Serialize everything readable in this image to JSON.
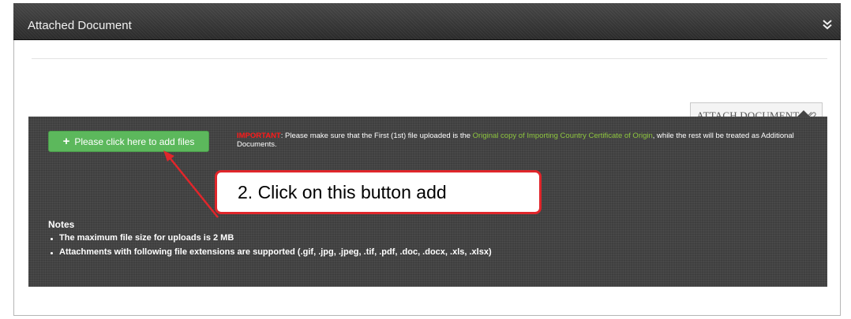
{
  "panel": {
    "title": "Attached Document"
  },
  "icons": {
    "collapse": "double-chevron-down-icon",
    "paperclip": "paperclip-icon",
    "plus": "plus-icon"
  },
  "attach_button": {
    "label": "ATTACH DOCUMENT"
  },
  "upload": {
    "add_files_label": "Please click here to add files",
    "important_label": "IMPORTANT",
    "important_text_1": ": Please make sure that the First (1st) file uploaded is the ",
    "important_highlight": "Original copy of Importing Country Certificate of Origin",
    "important_text_2": ", while the rest will be treated as Additional Documents."
  },
  "notes": {
    "title": "Notes",
    "items": [
      "The maximum file size for uploads is 2 MB",
      "Attachments with following file extensions are supported (.gif, .jpg, .jpeg, .tif, .pdf, .doc, .docx, .xls, .xlsx)"
    ]
  },
  "annotation": {
    "callout_text": "2.  Click on this button add"
  },
  "colors": {
    "header_bg": "#333333",
    "add_button_green": "#5cb85c",
    "important_red": "#ff1a1a",
    "highlight_green": "#8ec63f",
    "callout_border": "#e0262b"
  }
}
